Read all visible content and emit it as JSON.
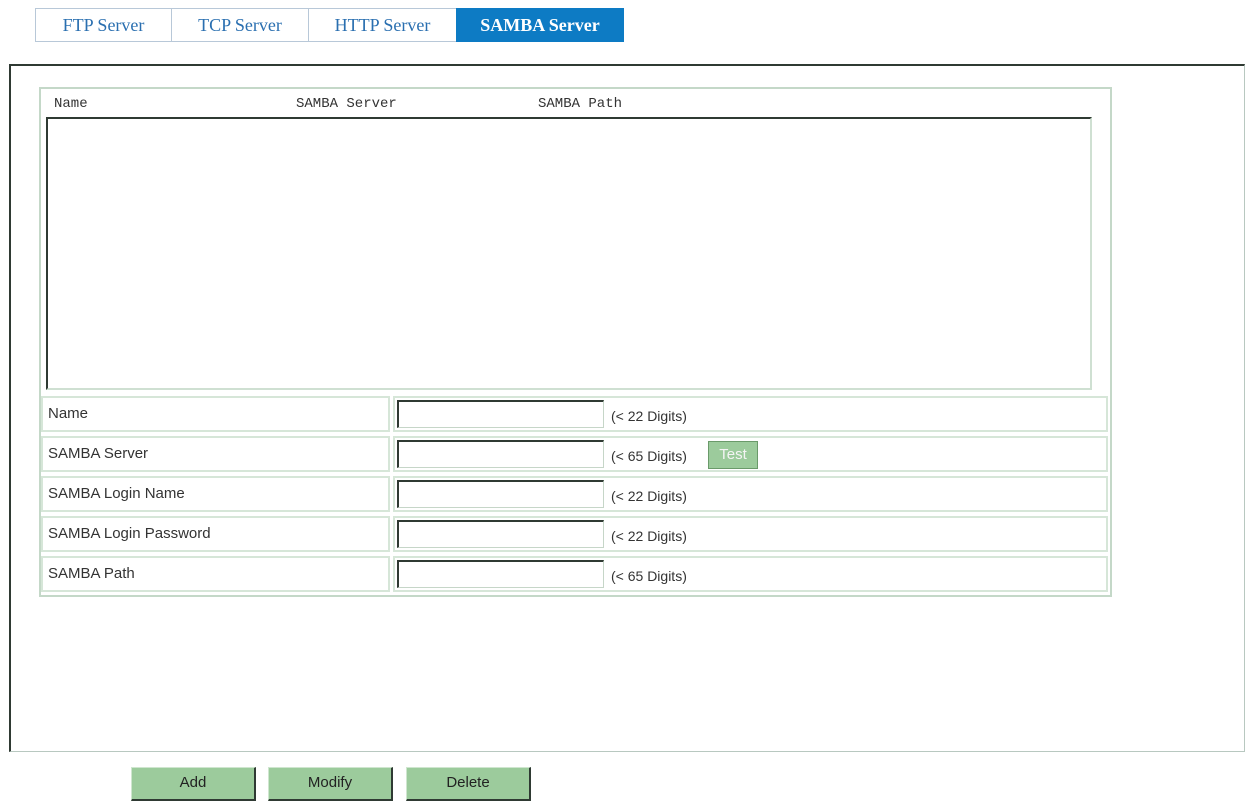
{
  "tabs": [
    {
      "label": "FTP Server"
    },
    {
      "label": "TCP Server"
    },
    {
      "label": "HTTP Server"
    },
    {
      "label": "SAMBA Server",
      "active": true
    }
  ],
  "list": {
    "columns": [
      "Name",
      "SAMBA Server",
      "SAMBA Path"
    ],
    "rows": []
  },
  "form": {
    "fields": [
      {
        "label": "Name",
        "value": "",
        "hint": "(< 22 Digits)"
      },
      {
        "label": "SAMBA Server",
        "value": "",
        "hint": "(< 65 Digits)",
        "button": "Test"
      },
      {
        "label": "SAMBA Login Name",
        "value": "",
        "hint": "(< 22 Digits)"
      },
      {
        "label": "SAMBA Login Password",
        "value": "",
        "hint": "(< 22 Digits)"
      },
      {
        "label": "SAMBA Path",
        "value": "",
        "hint": "(< 65 Digits)"
      }
    ]
  },
  "actions": {
    "add": "Add",
    "modify": "Modify",
    "delete": "Delete"
  },
  "colors": {
    "active_tab": "#0d7bc4",
    "tab_text": "#2a6fb0",
    "button_green": "#9ccb9c",
    "border_green": "#d6e6d8"
  }
}
